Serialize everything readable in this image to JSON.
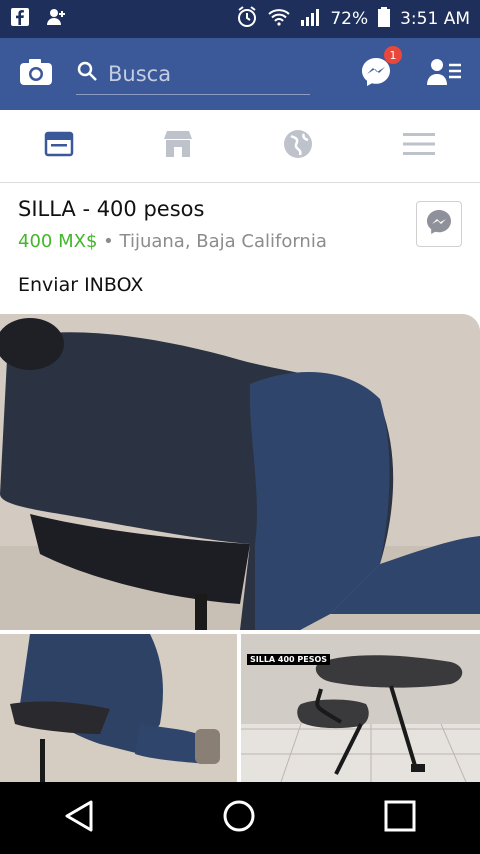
{
  "status_bar": {
    "battery": "72%",
    "time": "3:51 AM"
  },
  "app_bar": {
    "search_placeholder": "Busca",
    "messenger_badge": "1"
  },
  "listing": {
    "title": "SILLA - 400 pesos",
    "price": "400 MX$",
    "separator": "•",
    "location": "Tijuana, Baja California",
    "note": "Enviar INBOX"
  },
  "photos": {
    "caption": "SILLA 400 PESOS"
  },
  "colors": {
    "brand": "#3b5998",
    "price": "#42b72a",
    "statusbar": "#1d2f5a"
  }
}
